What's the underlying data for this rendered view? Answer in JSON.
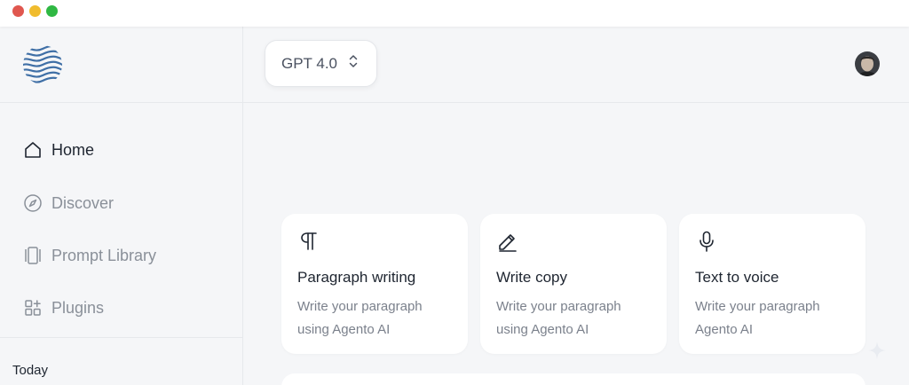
{
  "window": {
    "controls": [
      "close",
      "minimize",
      "maximize"
    ]
  },
  "sidebar": {
    "logo": "wave-logo",
    "items": [
      {
        "label": "Home",
        "icon": "home-icon",
        "active": true
      },
      {
        "label": "Discover",
        "icon": "compass-icon",
        "active": false
      },
      {
        "label": "Prompt Library",
        "icon": "library-icon",
        "active": false
      },
      {
        "label": "Plugins",
        "icon": "plugins-icon",
        "active": false
      }
    ],
    "section_title": "Today"
  },
  "header": {
    "model_label": "GPT 4.0",
    "model_icon": "chevron-up-down-icon",
    "avatar": "user-avatar"
  },
  "cards": [
    {
      "title": "Paragraph writing",
      "description": "Write your paragraph using Agento AI",
      "icon": "pilcrow-icon"
    },
    {
      "title": "Write copy",
      "description": "Write your paragraph using Agento AI",
      "icon": "pencil-icon"
    },
    {
      "title": "Text to voice",
      "description": "Write your paragraph Agento AI",
      "icon": "microphone-icon"
    }
  ],
  "colors": {
    "background": "#f5f6f8",
    "card": "#ffffff",
    "text_primary": "#1e2530",
    "text_muted": "#8a9099",
    "logo_blue": "#3f6fa6"
  }
}
